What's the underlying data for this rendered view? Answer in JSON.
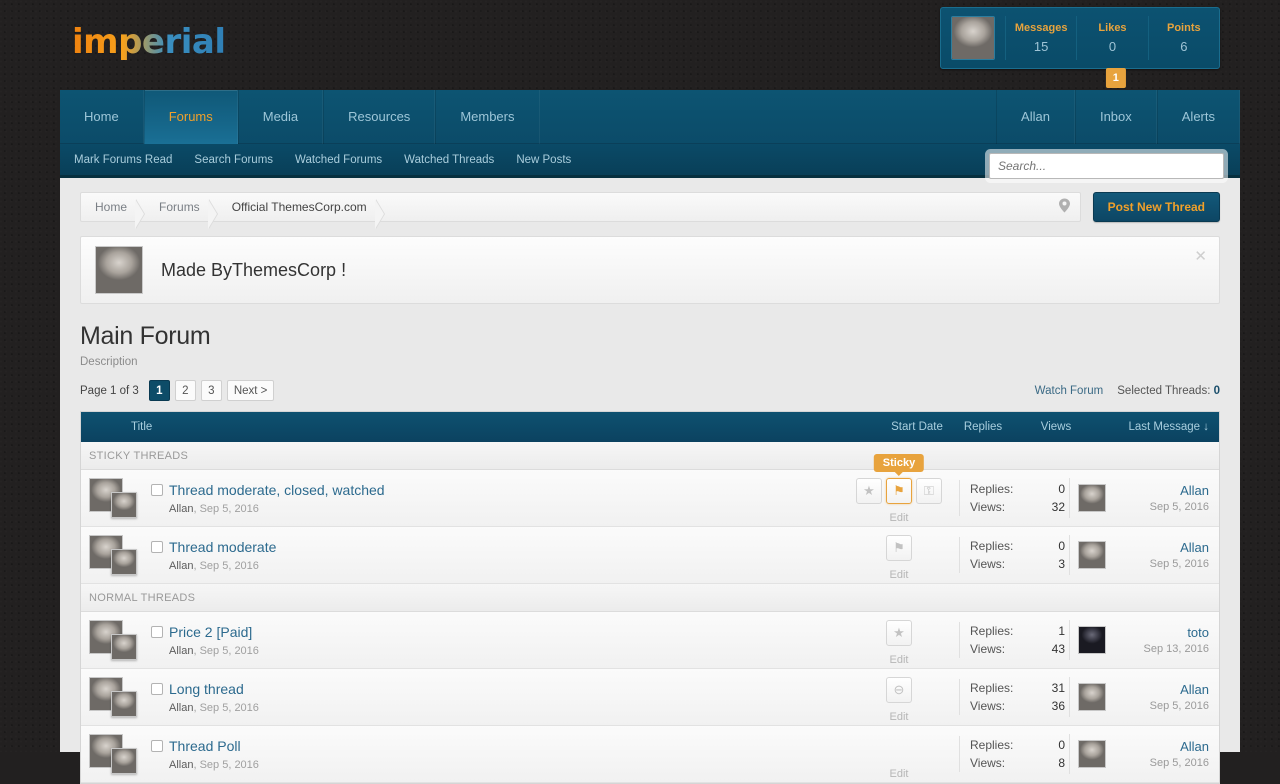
{
  "site": {
    "logo_text": "imperial"
  },
  "user_panel": {
    "avatar": "user-avatar",
    "stats": [
      {
        "label": "Messages",
        "value": "15"
      },
      {
        "label": "Likes",
        "value": "0"
      },
      {
        "label": "Points",
        "value": "6"
      }
    ]
  },
  "nav": {
    "tabs": [
      {
        "label": "Home",
        "active": false
      },
      {
        "label": "Forums",
        "active": true
      },
      {
        "label": "Media",
        "active": false
      },
      {
        "label": "Resources",
        "active": false
      },
      {
        "label": "Members",
        "active": false
      }
    ],
    "right": [
      {
        "label": "Allan",
        "badge": ""
      },
      {
        "label": "Inbox",
        "badge": "1"
      },
      {
        "label": "Alerts",
        "badge": ""
      }
    ]
  },
  "subnav": {
    "links": [
      "Mark Forums Read",
      "Search Forums",
      "Watched Forums",
      "Watched Threads",
      "New Posts"
    ],
    "search_placeholder": "Search...",
    "search_value": ""
  },
  "breadcrumb": {
    "items": [
      "Home",
      "Forums",
      "Official ThemesCorp.com"
    ],
    "pin_icon": "location-pin-icon"
  },
  "post_button": {
    "label": "Post New Thread"
  },
  "notice": {
    "text": "Made ByThemesCorp !",
    "close_icon": "close-icon"
  },
  "forum": {
    "title": "Main Forum",
    "description": "Description"
  },
  "pagination": {
    "page_label": "Page 1 of 3",
    "pages": [
      "1",
      "2",
      "3"
    ],
    "active_page": "1",
    "next_label": "Next >"
  },
  "forum_actions": {
    "watch_label": "Watch Forum",
    "selected_label": "Selected Threads:",
    "selected_count": "0"
  },
  "table": {
    "headers": {
      "title": "Title",
      "start_date": "Start Date",
      "replies": "Replies",
      "views": "Views",
      "last_message": "Last Message ↓"
    },
    "sections": [
      {
        "label": "STICKY THREADS",
        "threads": [
          {
            "title": "Thread moderate, closed, watched",
            "author": "Allan",
            "author_sep": ",",
            "start_date": "Sep 5, 2016",
            "icons": [
              {
                "name": "star-icon",
                "glyph": "★",
                "highlight": false
              },
              {
                "name": "pin-icon",
                "glyph": "⚑",
                "highlight": true,
                "tooltip": "Sticky"
              },
              {
                "name": "lock-icon",
                "glyph": "⚿",
                "highlight": false
              }
            ],
            "edit_label": "Edit",
            "replies_label": "Replies:",
            "replies": "0",
            "views_label": "Views:",
            "views": "32",
            "last_user": "Allan",
            "last_date": "Sep 5, 2016",
            "last_avatar_style": "light"
          },
          {
            "title": "Thread moderate",
            "author": "Allan",
            "author_sep": ",",
            "start_date": "Sep 5, 2016",
            "icons": [
              {
                "name": "pin-icon",
                "glyph": "⚑",
                "highlight": false
              }
            ],
            "edit_label": "Edit",
            "replies_label": "Replies:",
            "replies": "0",
            "views_label": "Views:",
            "views": "3",
            "last_user": "Allan",
            "last_date": "Sep 5, 2016",
            "last_avatar_style": "light"
          }
        ]
      },
      {
        "label": "NORMAL THREADS",
        "threads": [
          {
            "title": "Price 2 [Paid]",
            "author": "Allan",
            "author_sep": ",",
            "start_date": "Sep 5, 2016",
            "icons": [
              {
                "name": "star-icon",
                "glyph": "★",
                "highlight": false
              }
            ],
            "edit_label": "Edit",
            "replies_label": "Replies:",
            "replies": "1",
            "views_label": "Views:",
            "views": "43",
            "last_user": "toto",
            "last_date": "Sep 13, 2016",
            "last_avatar_style": "dark"
          },
          {
            "title": "Long thread",
            "author": "Allan",
            "author_sep": ",",
            "start_date": "Sep 5, 2016",
            "icons": [
              {
                "name": "minus-circle-icon",
                "glyph": "⊖",
                "highlight": false
              }
            ],
            "edit_label": "Edit",
            "replies_label": "Replies:",
            "replies": "31",
            "views_label": "Views:",
            "views": "36",
            "last_user": "Allan",
            "last_date": "Sep 5, 2016",
            "last_avatar_style": "light"
          },
          {
            "title": "Thread Poll",
            "author": "Allan",
            "author_sep": ",",
            "start_date": "Sep 5, 2016",
            "icons": [],
            "edit_label": "Edit",
            "replies_label": "Replies:",
            "replies": "0",
            "views_label": "Views:",
            "views": "8",
            "last_user": "Allan",
            "last_date": "Sep 5, 2016",
            "last_avatar_style": "light"
          }
        ]
      }
    ]
  },
  "colors": {
    "page_bg": "#222020",
    "nav_blue": "#0d5472",
    "accent_orange": "#e8a33d",
    "link_blue": "#2c6a8e",
    "content_bg": "#e9e9e9"
  }
}
